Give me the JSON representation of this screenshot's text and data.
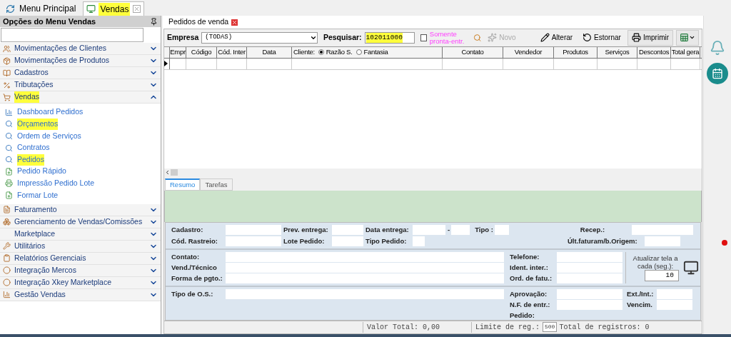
{
  "top_tabs": [
    {
      "label": "Menu Principal",
      "selected": false,
      "highlighted": false,
      "closable": false
    },
    {
      "label": "Vendas",
      "selected": true,
      "highlighted": true,
      "closable": true
    }
  ],
  "sidebar": {
    "title": "Opções do Menu Vendas",
    "sections": [
      {
        "label": "Movimentações de Clientes",
        "expanded": false,
        "highlighted": false
      },
      {
        "label": "Movimentações de Produtos",
        "expanded": false,
        "highlighted": false
      },
      {
        "label": "Cadastros",
        "expanded": false,
        "highlighted": false
      },
      {
        "label": "Tributações",
        "expanded": false,
        "highlighted": false
      },
      {
        "label": "Vendas",
        "expanded": true,
        "highlighted": true,
        "items": [
          {
            "label": "Dashboard Pedidos",
            "highlighted": false
          },
          {
            "label": "Orçamentos",
            "highlighted": true
          },
          {
            "label": "Ordem de Serviços",
            "highlighted": false
          },
          {
            "label": "Contratos",
            "highlighted": false
          },
          {
            "label": "Pedidos",
            "highlighted": true
          },
          {
            "label": "Pedido Rápido",
            "highlighted": false
          },
          {
            "label": "Impressão Pedido Lote",
            "highlighted": false
          },
          {
            "label": "Formar Lote",
            "highlighted": false
          }
        ]
      },
      {
        "label": "Faturamento",
        "expanded": false,
        "highlighted": false
      },
      {
        "label": "Gerenciamento de Vendas/Comissões",
        "expanded": false,
        "highlighted": false
      },
      {
        "label": "Marketplace",
        "expanded": false,
        "highlighted": false
      },
      {
        "label": "Utilitários",
        "expanded": false,
        "highlighted": false
      },
      {
        "label": "Relatórios Gerenciais",
        "expanded": false,
        "highlighted": false
      },
      {
        "label": "Integração Mercos",
        "expanded": false,
        "highlighted": false
      },
      {
        "label": "Integração Xkey Marketplace",
        "expanded": false,
        "highlighted": false
      },
      {
        "label": "Gestão Vendas",
        "expanded": false,
        "highlighted": false
      }
    ]
  },
  "document_tab": {
    "label": "Pedidos de venda"
  },
  "toolbar": {
    "empresa_label": "Empresa",
    "empresa_value": "(TODAS)",
    "search_label": "Pesquisar:",
    "search_value": "102011000",
    "search_highlighted": true,
    "checkbox": {
      "label": "Somente pronta-entr.",
      "checked": false
    },
    "buttons": [
      {
        "label": "Novo",
        "disabled": true
      },
      {
        "label": "Alterar",
        "disabled": false
      },
      {
        "label": "Estornar",
        "disabled": false
      },
      {
        "label": "Imprimir",
        "disabled": false
      }
    ]
  },
  "table": {
    "columns": [
      {
        "label": "Empr"
      },
      {
        "label": "Código"
      },
      {
        "label": "Cód. Inter"
      },
      {
        "label": "Data"
      },
      {
        "label": "Cliente:",
        "radios": [
          {
            "label": "Razão S.",
            "selected": true
          },
          {
            "label": "Fantasia",
            "selected": false
          }
        ]
      },
      {
        "label": "Contato"
      },
      {
        "label": "Vendedor"
      },
      {
        "label": "Produtos"
      },
      {
        "label": "Serviços"
      },
      {
        "label": "Descontos"
      },
      {
        "label": "Total gera"
      }
    ]
  },
  "lower_tabs": [
    {
      "label": "Resumo",
      "selected": true
    },
    {
      "label": "Tarefas",
      "selected": false
    }
  ],
  "form": {
    "row_1": [
      "Cadastro:",
      "Prev. entrega:",
      "Data entrega:",
      "-",
      "Tipo :",
      "Recep.:"
    ],
    "row_2": [
      "Cód. Rastreio:",
      "Lote Pedido:",
      "Tipo Pedido:",
      "Últ.faturam/b.Origem:"
    ],
    "contact": [
      "Contato:",
      "Vend./Técnico",
      "Forma de pgto.:"
    ],
    "contact_right": [
      "Telefone:",
      "Ident. inter.:",
      "Ord. de fatu.:"
    ],
    "refresh": {
      "label": "Atualizar tela a cada (seg.):",
      "value": "10"
    },
    "os_label": "Tipo de O.S.:",
    "os_mid": [
      "Aprovação:",
      "N.F. de entr.:",
      "Pedido:"
    ],
    "os_right": [
      "Ext./Int.:",
      "Vencim."
    ]
  },
  "status_bar": {
    "total": "Valor Total: 0,00",
    "limit_label": "Limite de reg.:",
    "limit_value": "500",
    "records": "Total de registros: 0"
  }
}
